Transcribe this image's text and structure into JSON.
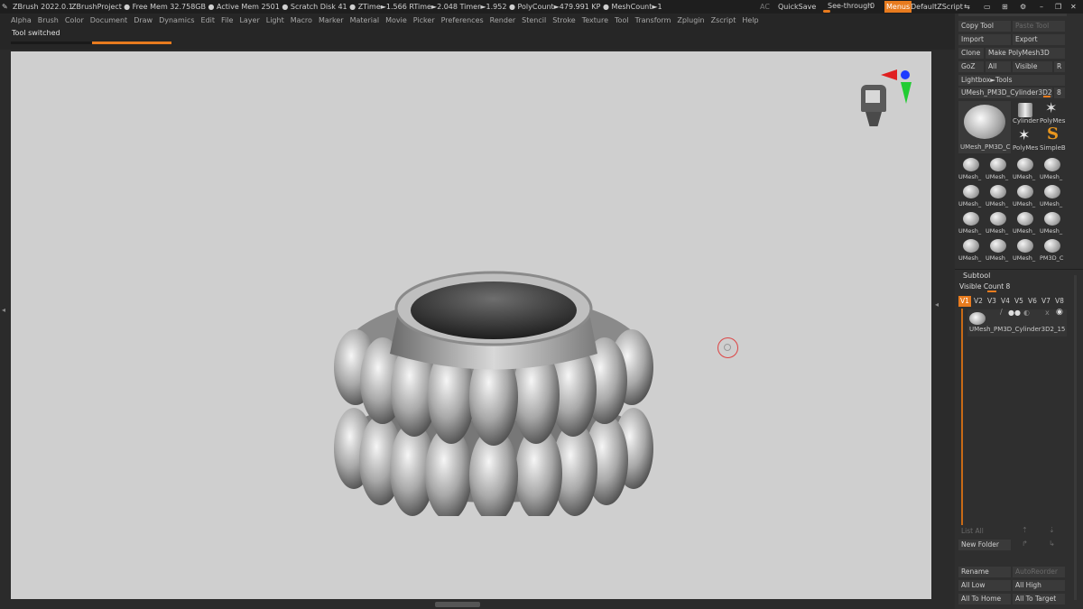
{
  "titlebar": {
    "app": "ZBrush 2022.0.1",
    "project": "ZBrushProject",
    "stats": ". ● Free Mem 32.758GB ● Active Mem 2501 ● Scratch Disk 41 ● ZTime►1.566 RTime►2.048 Timer►1.952 ● PolyCount►479.991 KP ● MeshCount►1",
    "ac": "AC",
    "quicksave": "QuickSave",
    "seethrough": "See-through",
    "seethrough_value": "0",
    "menus": "Menus",
    "script": "DefaultZScript"
  },
  "menubar": [
    "Alpha",
    "Brush",
    "Color",
    "Document",
    "Draw",
    "Dynamics",
    "Edit",
    "File",
    "Layer",
    "Light",
    "Macro",
    "Marker",
    "Material",
    "Movie",
    "Picker",
    "Preferences",
    "Render",
    "Stencil",
    "Stroke",
    "Texture",
    "Tool",
    "Transform",
    "Zplugin",
    "Zscript",
    "Help"
  ],
  "status": {
    "message": "Tool switched"
  },
  "tool_panel": {
    "copy_tool": "Copy Tool",
    "paste_tool": "Paste Tool",
    "import": "Import",
    "export": "Export",
    "clone": "Clone",
    "make_polymesh": "Make PolyMesh3D",
    "goz": "GoZ",
    "all": "All",
    "visible": "Visible",
    "r": "R",
    "lightbox": "Lightbox►Tools",
    "current_tool": "UMesh_PM3D_Cylinder3D2_1",
    "current_tool_count": "8",
    "main_thumb_caption": "UMesh_PM3D_C",
    "cylinder": "Cylinder",
    "polymesh": "PolyMes",
    "polymesh2": "PolyMes",
    "simpleb": "SimpleB",
    "thumbs": [
      "UMesh_",
      "UMesh_",
      "UMesh_",
      "UMesh_",
      "UMesh_",
      "UMesh_",
      "UMesh_",
      "UMesh_",
      "UMesh_",
      "UMesh_",
      "UMesh_",
      "UMesh_",
      "UMesh_",
      "UMesh_",
      "UMesh_",
      "PM3D_C"
    ]
  },
  "subtool": {
    "title": "Subtool",
    "visible_count": "Visible Count 8",
    "versions": [
      "V1",
      "V2",
      "V3",
      "V4",
      "V5",
      "V6",
      "V7",
      "V8"
    ],
    "item_name": "UMesh_PM3D_Cylinder3D2_15",
    "list_all": "List All",
    "new_folder": "New Folder",
    "rename": "Rename",
    "autoreorder": "AutoReorder",
    "all_low": "All Low",
    "all_high": "All High",
    "all_to_home": "All To Home",
    "all_to_target": "All To Target"
  },
  "colors": {
    "accent": "#e87b1e",
    "viewport_bg": "#cfcfcf",
    "panel_bg": "#2b2b2b"
  }
}
